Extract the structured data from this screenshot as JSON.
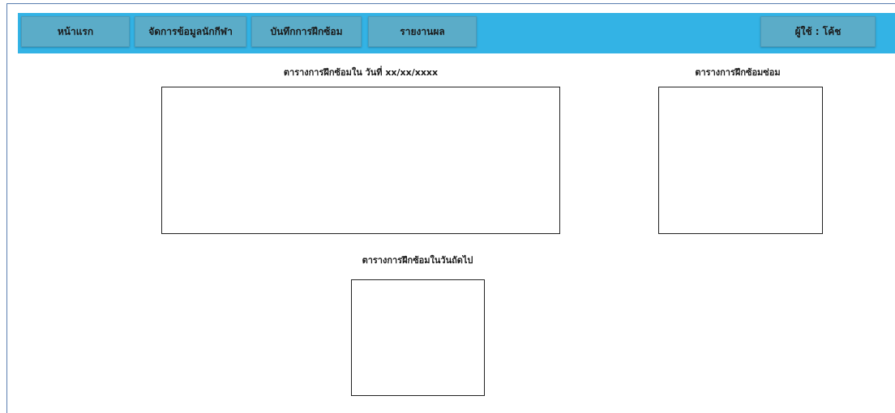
{
  "navbar": {
    "home_label": "หน้าแรก",
    "manage_athletes_label": "จัดการข้อมูลนักกีฬา",
    "record_training_label": "บันทึกการฝึกซ้อม",
    "report_label": "รายงานผล",
    "user_label": "ผู้ใช้ : โค้ช"
  },
  "sections": {
    "today_schedule_title": "ตารางการฝึกซ้อมใน วันที่ xx/xx/xxxx",
    "make_up_schedule_title": "ตารางการฝึกซ้อมซ่อม",
    "next_day_schedule_title": "ตารางการฝึกซ้อมในวันถัดไป"
  },
  "colors": {
    "navbar_background": "#33b3e5",
    "button_background": "#5bacc8"
  }
}
